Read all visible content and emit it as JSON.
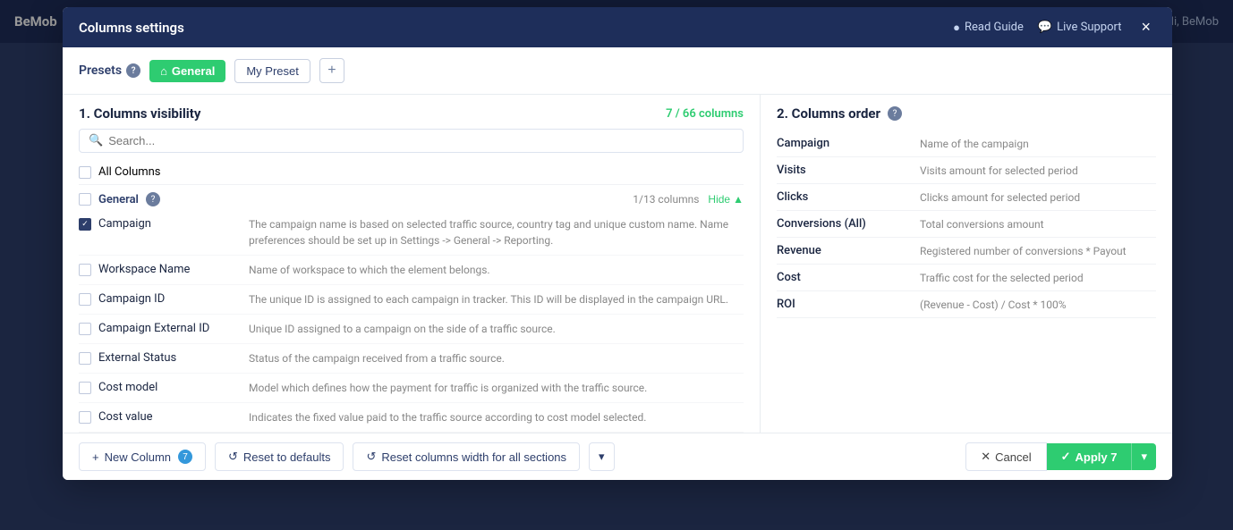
{
  "app": {
    "logo": "BeMob",
    "header_links": [
      {
        "label": "Read Guide",
        "icon": "book-icon"
      },
      {
        "label": "Live Support",
        "icon": "chat-icon"
      }
    ],
    "user": "Hi, BeMob"
  },
  "modal": {
    "title": "Columns settings",
    "close_label": "×",
    "presets_label": "Presets",
    "preset_active": "General",
    "preset_home_icon": "home-icon",
    "preset_my": "My Preset",
    "preset_add": "+",
    "section1_title": "1. Columns visibility",
    "columns_count": "7 / 66 columns",
    "search_placeholder": "Search...",
    "all_columns_label": "All Columns",
    "group_name": "General",
    "group_help_icon": "help-icon",
    "group_count": "1/13 columns",
    "group_hide_label": "Hide",
    "group_hide_icon": "chevron-up-icon",
    "columns": [
      {
        "name": "Campaign",
        "checked": true,
        "desc": "The campaign name is based on selected traffic source, country tag and unique custom name. Name preferences should be set up in Settings -> General -> Reporting."
      },
      {
        "name": "Workspace Name",
        "checked": false,
        "desc": "Name of workspace to which the element belongs."
      },
      {
        "name": "Campaign ID",
        "checked": false,
        "desc": "The unique ID is assigned to each campaign in tracker. This ID will be displayed in the campaign URL."
      },
      {
        "name": "Campaign External ID",
        "checked": false,
        "desc": "Unique ID assigned to a campaign on the side of a traffic source."
      },
      {
        "name": "External Status",
        "checked": false,
        "desc": "Status of the campaign received from a traffic source."
      },
      {
        "name": "Cost model",
        "checked": false,
        "desc": "Model which defines how the payment for traffic is organized with the traffic source."
      },
      {
        "name": "Cost value",
        "checked": false,
        "desc": "Indicates the fixed value paid to the traffic source according to cost model selected."
      }
    ],
    "section2_title": "2. Columns order",
    "section2_help_icon": "help-icon",
    "order_columns": [
      {
        "name": "Campaign",
        "desc": "Name of the campaign"
      },
      {
        "name": "Visits",
        "desc": "Visits amount for selected period"
      },
      {
        "name": "Clicks",
        "desc": "Clicks amount for selected period"
      },
      {
        "name": "Conversions (All)",
        "desc": "Total conversions amount"
      },
      {
        "name": "Revenue",
        "desc": "Registered number of conversions * Payout"
      },
      {
        "name": "Cost",
        "desc": "Traffic cost for the selected period"
      },
      {
        "name": "ROI",
        "desc": "(Revenue - Cost) / Cost * 100%"
      }
    ],
    "footer": {
      "new_column_label": "New Column",
      "new_column_badge": "7",
      "reset_defaults_label": "Reset to defaults",
      "reset_defaults_icon": "reset-icon",
      "reset_width_label": "Reset columns width for all sections",
      "reset_width_icon": "reset-icon",
      "dropdown_icon": "chevron-down-icon",
      "cancel_label": "Cancel",
      "cancel_icon": "x-icon",
      "apply_label": "Apply 7",
      "apply_check_icon": "check-icon",
      "apply_dropdown_icon": "chevron-down-icon"
    }
  }
}
